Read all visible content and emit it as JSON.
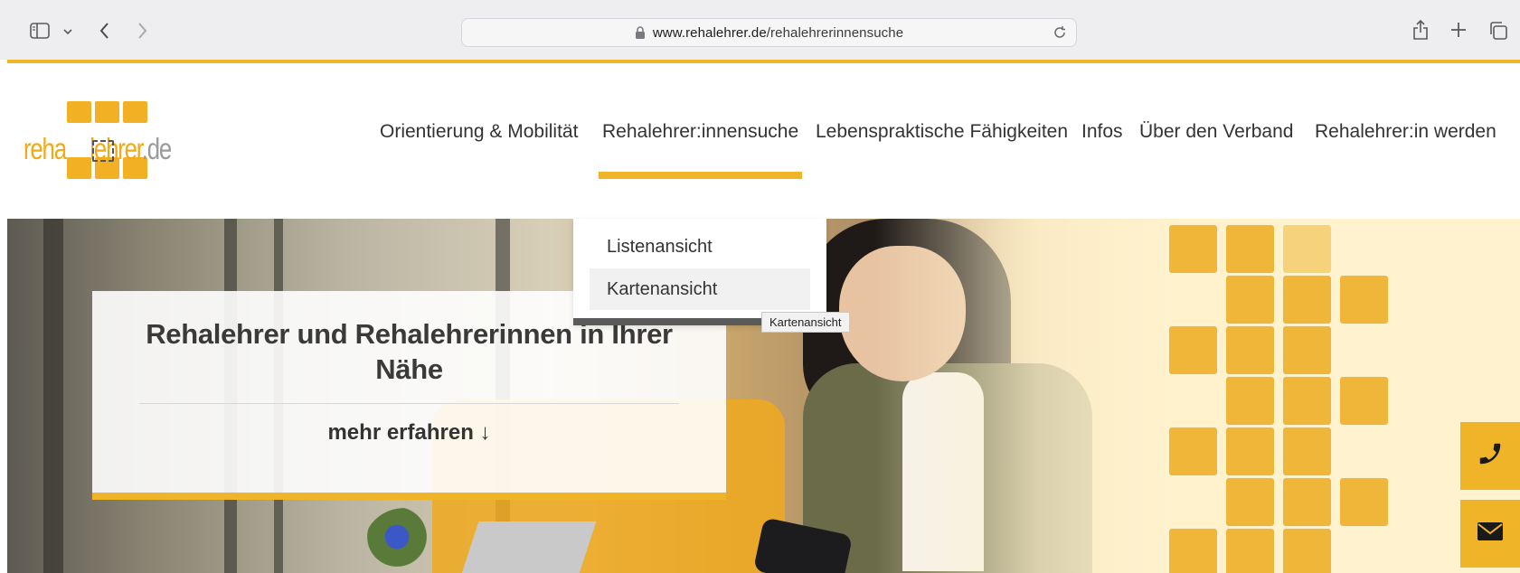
{
  "browser": {
    "url_domain": "www.rehalehrer.de",
    "url_path": "/rehalehrerinnensuche",
    "icons": [
      "sidebar-icon",
      "chevron-down-icon",
      "back-icon",
      "forward-icon",
      "lock-icon",
      "reload-icon",
      "share-icon",
      "new-tab-icon",
      "tabs-overview-icon"
    ]
  },
  "site": {
    "logo": {
      "word_left": "reha",
      "word_right": "lehrer",
      "word_tld": ".de"
    },
    "nav": [
      {
        "label": "Orientierung & Mobilität"
      },
      {
        "label": "Rehalehrer:innensuche",
        "active": true
      },
      {
        "label": "Lebenspraktische Fähigkeiten"
      },
      {
        "label": "Infos"
      },
      {
        "label": "Über den Verband"
      },
      {
        "label": "Rehalehrer:in werden"
      }
    ],
    "dropdown": {
      "items": [
        {
          "label": "Listenansicht"
        },
        {
          "label": "Kartenansicht",
          "hovered": true
        }
      ]
    },
    "tooltip": "Kartenansicht",
    "hero": {
      "title": "Rehalehrer und Rehalehrerinnen in Ihrer Nähe",
      "more": "mehr erfahren ↓"
    },
    "side_buttons": [
      "phone-icon",
      "mail-icon"
    ],
    "colors": {
      "accent": "#f0b429",
      "text": "#333333"
    }
  }
}
